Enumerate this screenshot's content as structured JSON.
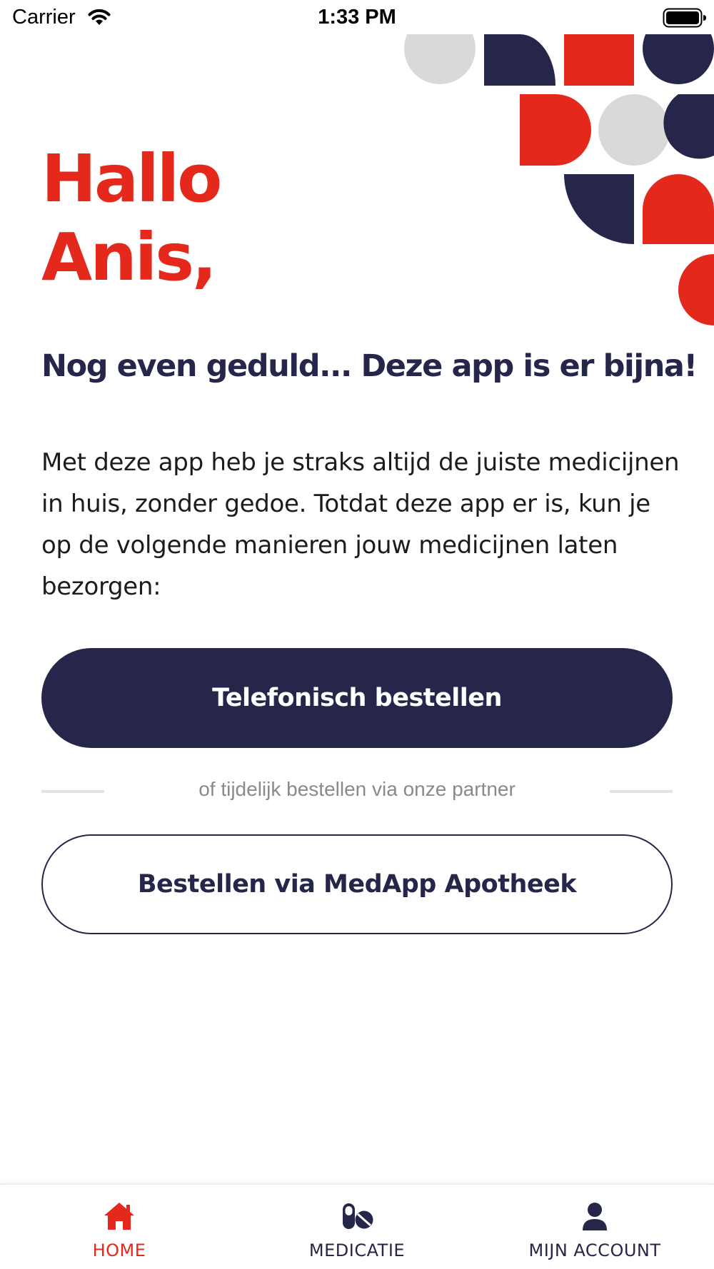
{
  "status_bar": {
    "carrier": "Carrier",
    "time": "1:33 PM"
  },
  "colors": {
    "accent_red": "#e4291c",
    "navy": "#26264a",
    "light_grey": "#d9d9d9"
  },
  "greeting": {
    "line1": "Hallo",
    "line2": "Anis,"
  },
  "subtitle": "Nog even geduld... Deze app is er bijna!",
  "body_text": "Met deze app heb je straks altijd de juiste medicijnen in huis, zonder gedoe. Totdat deze app er is, kun je op de volgende manieren jouw medicijnen laten bezorgen:",
  "primary_button": {
    "label": "Telefonisch bestellen"
  },
  "divider_text": "of tijdelijk bestellen via onze partner",
  "secondary_button": {
    "label": "Bestellen via MedApp Apotheek"
  },
  "tab_bar": {
    "tabs": [
      {
        "label": "HOME",
        "icon": "home-icon",
        "active": true
      },
      {
        "label": "MEDICATIE",
        "icon": "pills-icon",
        "active": false
      },
      {
        "label": "MIJN ACCOUNT",
        "icon": "user-icon",
        "active": false
      }
    ]
  }
}
